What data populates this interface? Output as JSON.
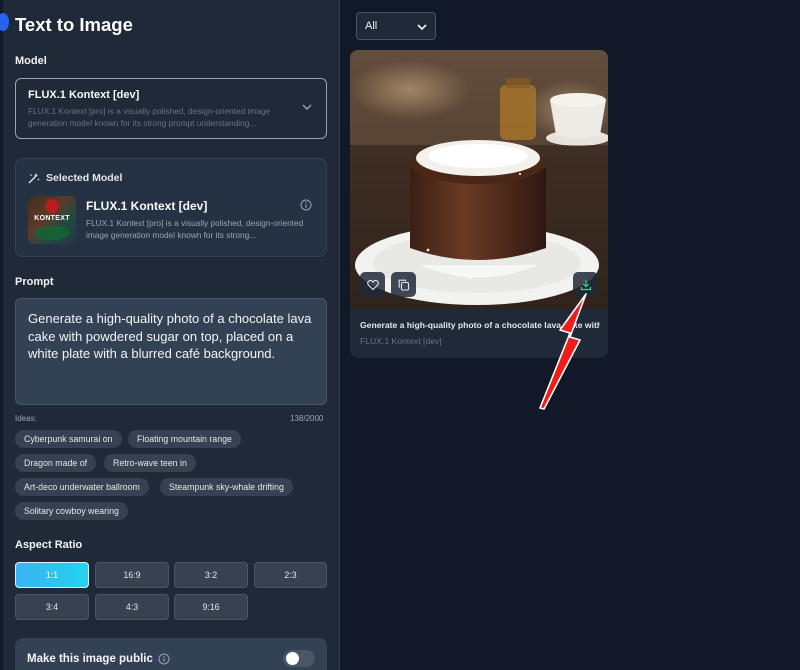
{
  "page": {
    "title": "Text to Image"
  },
  "model": {
    "label": "Model",
    "selected_name": "FLUX.1 Kontext [dev]",
    "selected_desc": "FLUX.1 Kontext [pro] is a visually polished, design-oriented image generation model known for its strong prompt understanding..."
  },
  "selected_model": {
    "label": "Selected Model",
    "name": "FLUX.1 Kontext [dev]",
    "desc": "FLUX.1 Kontext [pro] is a visually polished, design-oriented image generation model known for its strong...",
    "thumb_text": "KONTEXT"
  },
  "prompt": {
    "label": "Prompt",
    "value": "Generate a high-quality photo of a chocolate lava cake with powdered sugar on top, placed on a white plate with a blurred café background.",
    "ideas_label": "Ideas:",
    "counter": "138/2000",
    "ideas": [
      "Cyberpunk samurai on",
      "Floating mountain range",
      "Dragon made of",
      "Retro-wave teen in",
      "Art-deco underwater ballroom",
      "Steampunk sky-whale drifting",
      "Solitary cowboy wearing"
    ]
  },
  "aspect_ratio": {
    "label": "Aspect Ratio",
    "selected": "1:1",
    "options": [
      "1:1",
      "16:9",
      "3:2",
      "2:3",
      "3:4",
      "4:3",
      "9:16"
    ]
  },
  "public": {
    "label": "Make this image public",
    "enabled": false
  },
  "filter": {
    "value": "All"
  },
  "result": {
    "title": "Generate a high-quality photo of a chocolate lava cake with powdered sugar on top...",
    "model": "FLUX.1 Kontext [dev]"
  },
  "colors": {
    "accent": "#22d3ee",
    "panel": "#1f2937",
    "background": "#111827",
    "arrow": "#ef1c1c"
  }
}
